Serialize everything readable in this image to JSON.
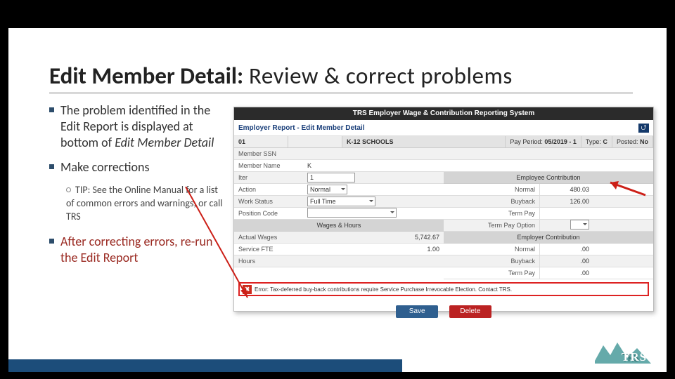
{
  "title": {
    "bold": "Edit Member Detail:",
    "light": " Review & correct problems"
  },
  "bullets": {
    "b1": {
      "pre": "The problem identified in the Edit Report is displayed at bottom of ",
      "em": "Edit Member Detail"
    },
    "b2": "Make corrections",
    "tip": "TIP: See the Online Manual for a list of common errors and warnings, or call TRS",
    "b3": "After correcting errors, re-run the Edit Report"
  },
  "shot": {
    "system_title": "TRS Employer Wage & Contribution Reporting System",
    "breadcrumb": "Employer Report - Edit Member Detail",
    "up_glyph": "⮍",
    "info": {
      "id": "01",
      "school": "K-12 SCHOOLS",
      "pay_period_lab": "Pay Period:",
      "pay_period": "05/2019 - 1",
      "type_lab": "Type:",
      "type": "C",
      "posted_lab": "Posted:",
      "posted": "No"
    },
    "rows": {
      "mem_ssn": "Member SSN",
      "mem_name_lab": "Member Name",
      "mem_name_v": "K",
      "iter_lab": "Iter",
      "iter_v": "1",
      "action_lab": "Action",
      "action_v": "Normal",
      "work_status_lab": "Work Status",
      "work_status_v": "Full Time",
      "position_code_lab": "Position Code",
      "emp_contrib": "Employee Contribution",
      "normal_lab": "Normal",
      "normal_v": "480.03",
      "buyback_lab": "Buyback",
      "buyback_v": "126.00",
      "term_pay_lab": "Term Pay",
      "term_opt_lab": "Term Pay Option",
      "wages_hours": "Wages & Hours",
      "emp_er_contrib": "Employer Contribution",
      "actual_wages_lab": "Actual Wages",
      "actual_wages_v": "5,742.67",
      "service_fte_lab": "Service FTE",
      "service_fte_v": "1.00",
      "hours_lab": "Hours",
      "zero": ".00"
    },
    "error": "Error: Tax-deferred buy-back contributions require Service Purchase Irrevocable Election.  Contact TRS.",
    "save": "Save",
    "delete": "Delete"
  },
  "logo_text": "TRS"
}
